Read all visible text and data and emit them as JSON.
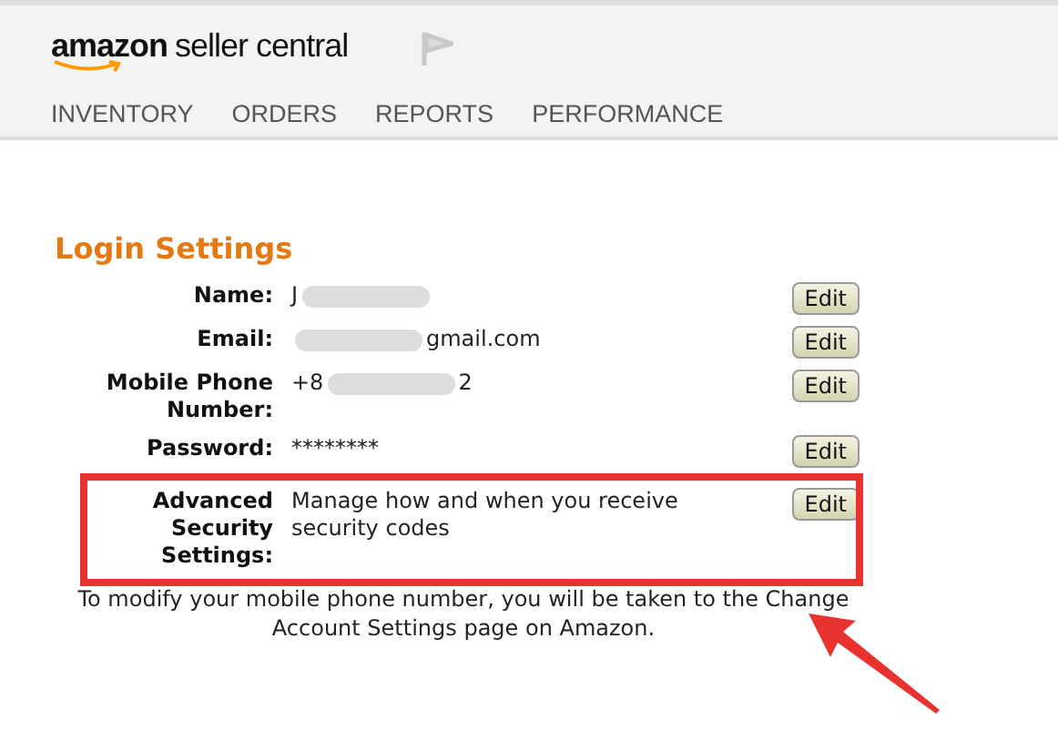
{
  "header": {
    "logo_brand": "amazon",
    "logo_product": "seller central",
    "nav": [
      {
        "label": "INVENTORY"
      },
      {
        "label": "ORDERS"
      },
      {
        "label": "REPORTS"
      },
      {
        "label": "PERFORMANCE"
      }
    ]
  },
  "section": {
    "title": "Login Settings",
    "rows": [
      {
        "label": "Name:",
        "value_before": "J",
        "redacted": true,
        "button": "Edit",
        "highlighted": false
      },
      {
        "label": "Email:",
        "redacted": true,
        "value_after": "gmail.com",
        "button": "Edit",
        "highlighted": false
      },
      {
        "label": "Mobile Phone Number:",
        "value_before": "+8",
        "redacted": true,
        "value_after": "2",
        "button": "Edit",
        "highlighted": false
      },
      {
        "label": "Password:",
        "value_before": "********",
        "redacted": false,
        "button": "Edit",
        "highlighted": false
      },
      {
        "label": "Advanced Security Settings:",
        "value_before": "Manage how and when you receive security codes",
        "redacted": false,
        "button": "Edit",
        "highlighted": true
      }
    ],
    "note": "To modify your mobile phone number, you will be taken to the Change Account Settings page on Amazon."
  }
}
